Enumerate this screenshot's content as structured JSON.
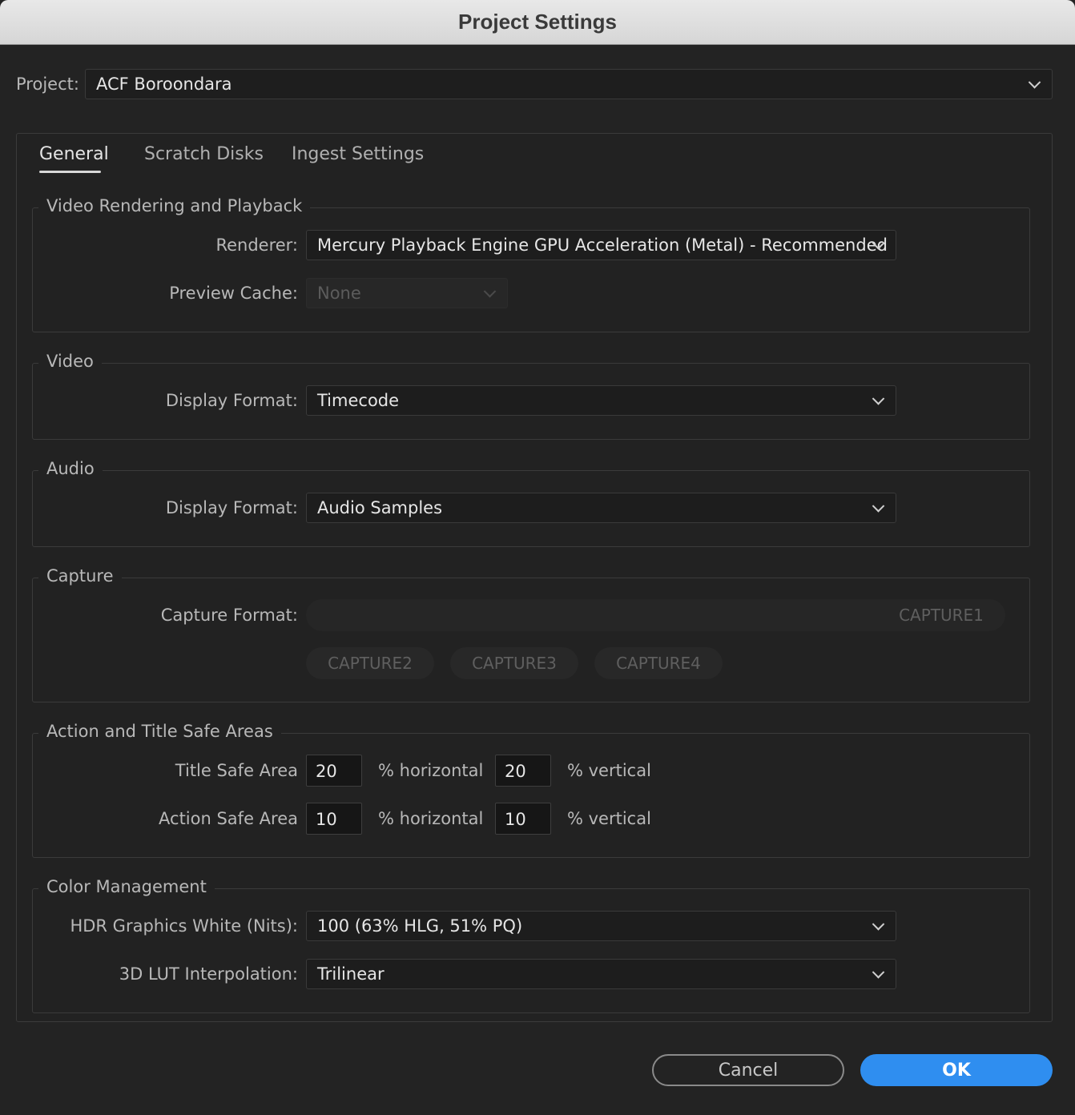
{
  "window": {
    "title": "Project Settings"
  },
  "project": {
    "label": "Project:",
    "value": "ACF Boroondara"
  },
  "tabs": [
    {
      "label": "General",
      "active": true
    },
    {
      "label": "Scratch Disks",
      "active": false
    },
    {
      "label": "Ingest Settings",
      "active": false
    }
  ],
  "sections": {
    "video_rendering": {
      "title": "Video Rendering and Playback",
      "renderer_label": "Renderer:",
      "renderer_value": "Mercury Playback Engine GPU Acceleration (Metal) - Recommended",
      "preview_cache_label": "Preview Cache:",
      "preview_cache_value": "None"
    },
    "video": {
      "title": "Video",
      "display_format_label": "Display Format:",
      "display_format_value": "Timecode"
    },
    "audio": {
      "title": "Audio",
      "display_format_label": "Display Format:",
      "display_format_value": "Audio Samples"
    },
    "capture": {
      "title": "Capture",
      "capture_format_label": "Capture Format:",
      "buttons": [
        "CAPTURE1",
        "CAPTURE2",
        "CAPTURE3",
        "CAPTURE4"
      ]
    },
    "safe_areas": {
      "title": "Action and Title Safe Areas",
      "title_safe_label": "Title Safe Area",
      "title_safe_h": "20",
      "title_safe_v": "20",
      "action_safe_label": "Action Safe Area",
      "action_safe_h": "10",
      "action_safe_v": "10",
      "horizontal_unit": "% horizontal",
      "vertical_unit": "% vertical"
    },
    "color": {
      "title": "Color Management",
      "hdr_label": "HDR Graphics White (Nits):",
      "hdr_value": "100 (63% HLG, 51% PQ)",
      "lut_label": "3D LUT Interpolation:",
      "lut_value": "Trilinear"
    }
  },
  "footer": {
    "cancel_label": "Cancel",
    "ok_label": "OK"
  },
  "colors": {
    "accent": "#2f8ef0",
    "background": "#232323",
    "titlebar": "#dcdcdc"
  }
}
